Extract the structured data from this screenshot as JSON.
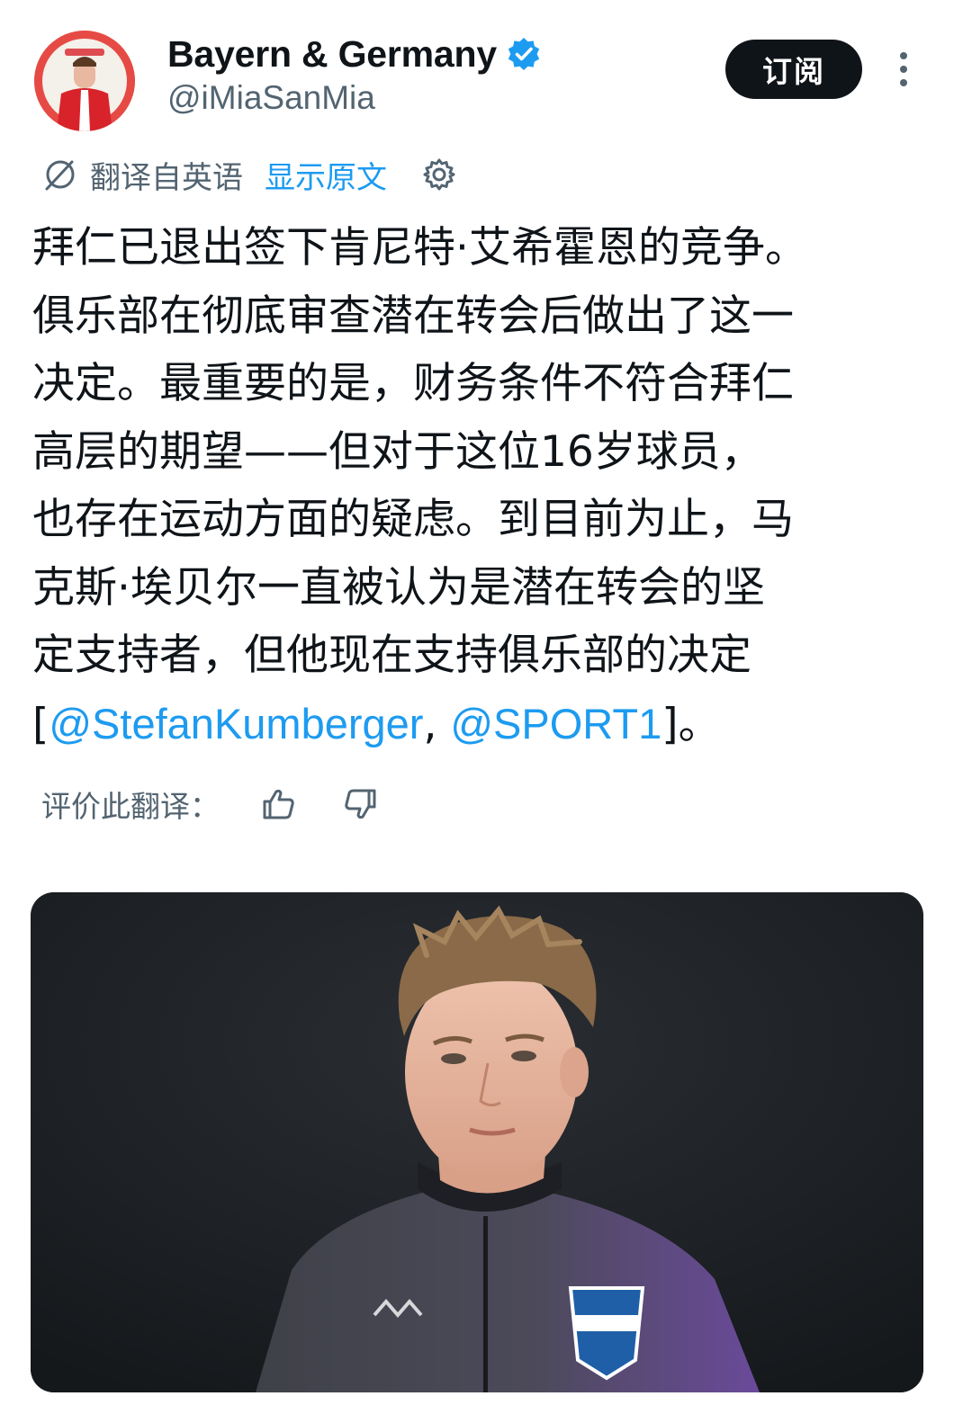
{
  "author": {
    "display_name": "Bayern & Germany",
    "handle": "@iMiaSanMia",
    "avatar_icon": "avatar-image",
    "verified_icon": "verified-badge-icon"
  },
  "actions": {
    "subscribe_label": "订阅",
    "more_icon": "more-dots-icon"
  },
  "translation": {
    "translated_from": "翻译自英语",
    "show_original": "显示原文",
    "settings_icon": "gear-icon"
  },
  "tweet": {
    "lines": [
      "拜仁已退出签下肯尼特·艾希霍恩的竞争。",
      "俱乐部在彻底审查潜在转会后做出了这一",
      "决定。最重要的是，财务条件不符合拜仁",
      "高层的期望——但对于这位16岁球员，",
      "也存在运动方面的疑虑。到目前为止，马",
      "克斯·埃贝尔一直被认为是潜在转会的坚",
      "定支持者，但他现在支持俱乐部的决定"
    ],
    "last_line": {
      "open_bracket": "[",
      "mention_1": "@StefanKumberger",
      "separator": ", ",
      "mention_2": "@SPORT1",
      "close": "]。"
    }
  },
  "rating": {
    "label": "评价此翻译：",
    "thumbs_up_icon": "thumbs-up-icon",
    "thumbs_down_icon": "thumbs-down-icon"
  },
  "media": {
    "image_icon": "player-photo",
    "colors": {
      "background": "#1c1f22",
      "jersey": "#4a4a58",
      "jersey_accent": "#6a4a9a",
      "hair": "#8a6a48",
      "skin": "#e8b8a0"
    }
  },
  "colors": {
    "text": "#0f1419",
    "secondary": "#536471",
    "link": "#1d9bf0",
    "button_bg": "#0f1419",
    "button_text": "#ffffff"
  }
}
